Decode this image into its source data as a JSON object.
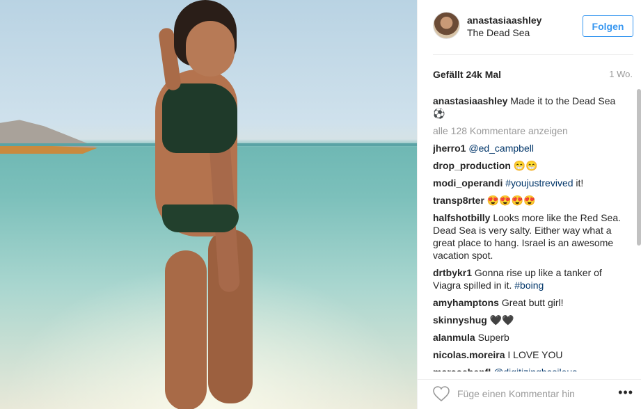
{
  "post": {
    "username": "anastasiaashley",
    "location": "The Dead Sea",
    "follow_label": "Folgen",
    "likes": "Gefällt 24k Mal",
    "time": "1 Wo.",
    "view_all": "alle 128 Kommentare anzeigen",
    "add_comment_placeholder": "Füge einen Kommentar hin",
    "more_label": "•••"
  },
  "caption": {
    "user": "anastasiaashley",
    "text": "Made it to the Dead Sea ⚽"
  },
  "comments": [
    {
      "user": "jherro1",
      "text": "",
      "link": "@ed_campbell",
      "tail": ""
    },
    {
      "user": "drop_production",
      "text": "😁😁",
      "link": "",
      "tail": ""
    },
    {
      "user": "modi_operandi",
      "text": "",
      "link": "#youjustrevived",
      "tail": " it!"
    },
    {
      "user": "transp8rter",
      "text": "😍😍😍😍",
      "link": "",
      "tail": ""
    },
    {
      "user": "halfshotbilly",
      "text": "Looks more like the Red Sea. Dead Sea is very salty. Either way what a great place to hang. Israel is an awesome vacation spot.",
      "link": "",
      "tail": ""
    },
    {
      "user": "drtbykr1",
      "text": "Gonna rise up like a tanker of Viagra spilled in it.",
      "link": "#boing",
      "tail": ""
    },
    {
      "user": "amyhamptons",
      "text": "Great butt girl!",
      "link": "",
      "tail": ""
    },
    {
      "user": "skinnyshug",
      "text": "🖤🖤",
      "link": "",
      "tail": ""
    },
    {
      "user": "alanmula",
      "text": "Superb",
      "link": "",
      "tail": ""
    },
    {
      "user": "nicolas.moreira",
      "text": "I LOVE YOU",
      "link": "",
      "tail": ""
    },
    {
      "user": "marcoebenfl",
      "text": "",
      "link": "@digitizingbasileus",
      "tail": ""
    }
  ],
  "colors": {
    "accent": "#3897f0",
    "link": "#003569",
    "muted": "#999999"
  }
}
